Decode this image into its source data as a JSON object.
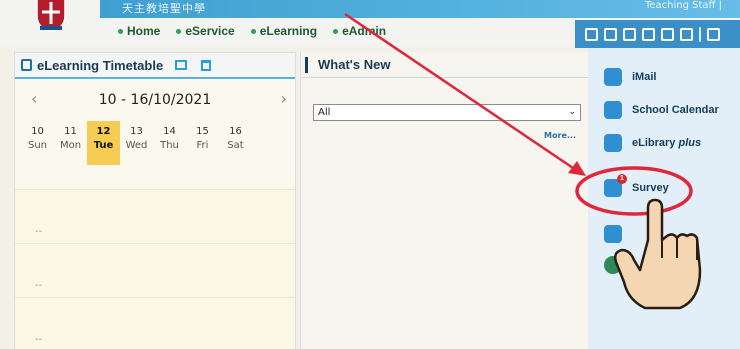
{
  "header": {
    "school_name": "天主教培聖中學",
    "user_name": "Teaching Staff |"
  },
  "main_nav": [
    {
      "label": "Home"
    },
    {
      "label": "eService"
    },
    {
      "label": "eLearning"
    },
    {
      "label": "eAdmin"
    }
  ],
  "timetable": {
    "title": "eLearning Timetable",
    "week_range": "10 - 16/10/2021",
    "prev_symbol": "‹",
    "next_symbol": "›",
    "days": [
      {
        "date": "10",
        "dow": "Sun"
      },
      {
        "date": "11",
        "dow": "Mon"
      },
      {
        "date": "12",
        "dow": "Tue"
      },
      {
        "date": "13",
        "dow": "Wed"
      },
      {
        "date": "14",
        "dow": "Thu"
      },
      {
        "date": "15",
        "dow": "Fri"
      },
      {
        "date": "16",
        "dow": "Sat"
      }
    ],
    "selected_day": "12",
    "slot_placeholder": "--"
  },
  "whats_new": {
    "title": "What's New",
    "filter_value": "All",
    "more_label": "More..."
  },
  "shortcuts": [
    {
      "label": "iMail",
      "icon": "mail-icon"
    },
    {
      "label": "School Calendar",
      "icon": "calendar-icon"
    },
    {
      "label": "eLibrary plus",
      "icon": "book-icon"
    },
    {
      "label": "Survey",
      "icon": "survey-icon",
      "badge": "1"
    }
  ],
  "colors": {
    "accent_blue": "#3b8fc7",
    "highlight_day": "#f5cd54",
    "annotation_red": "#e0263a"
  }
}
